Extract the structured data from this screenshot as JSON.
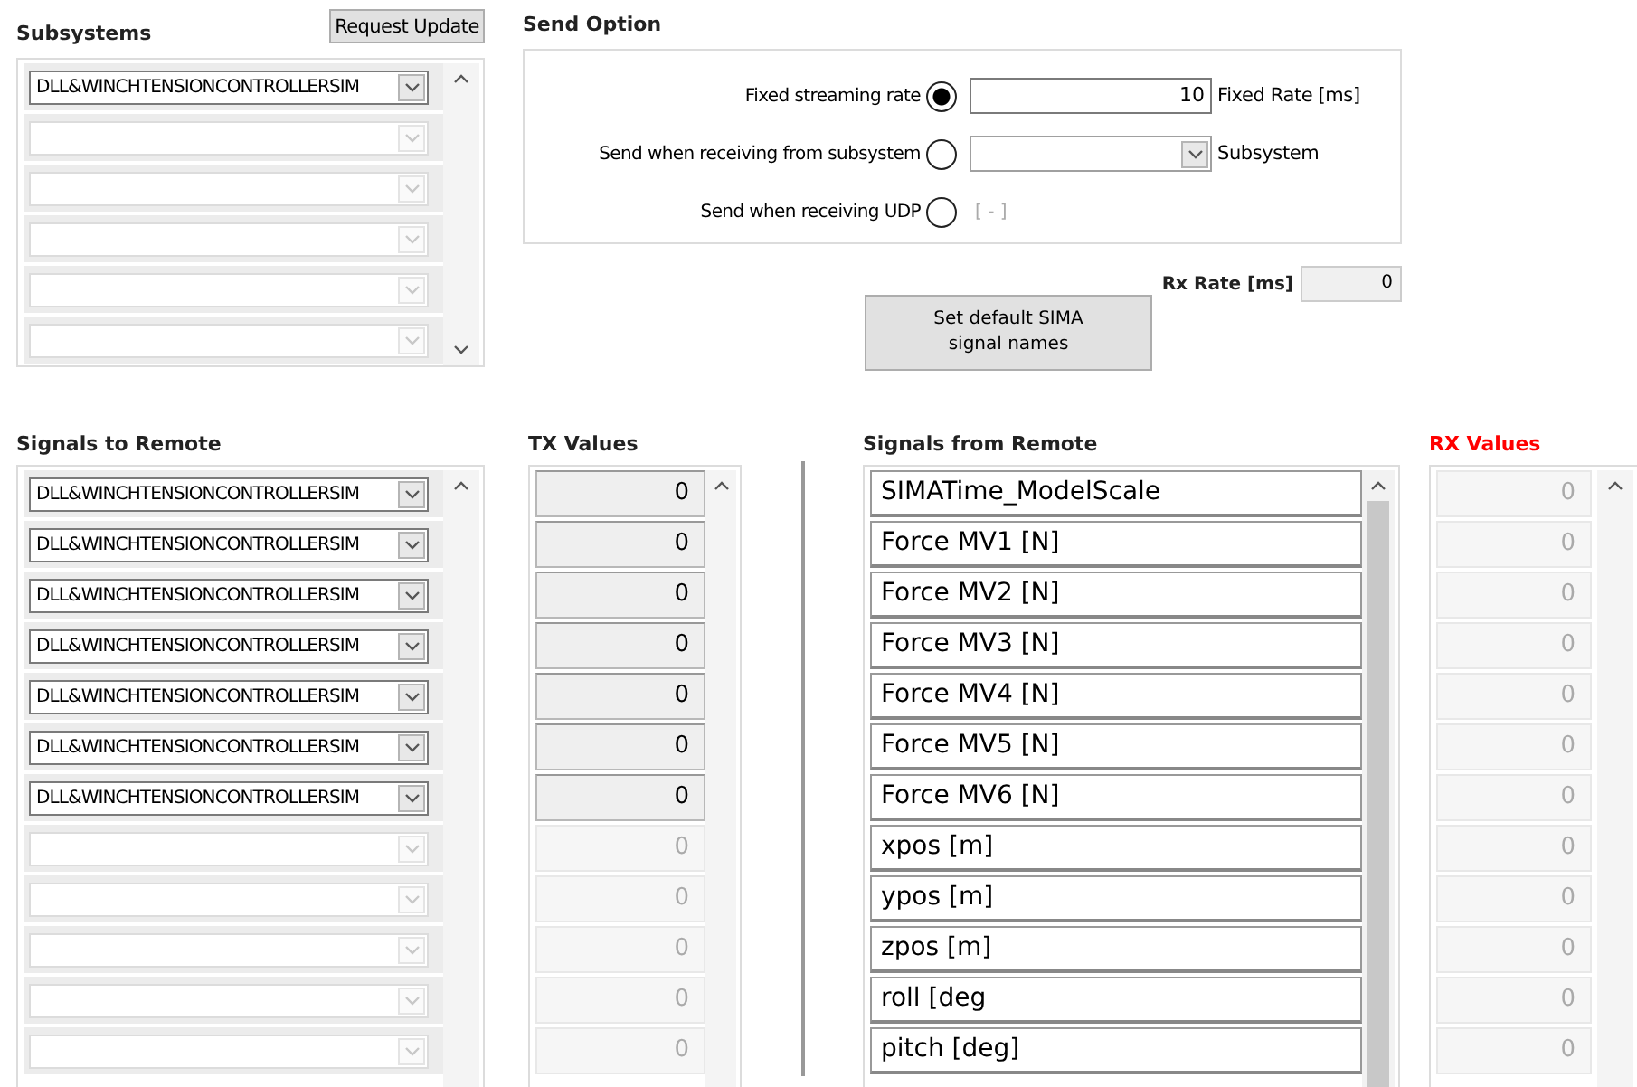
{
  "subsystems": {
    "title": "Subsystems",
    "request_button": "Request Update",
    "items": [
      {
        "value": "DLL&WINCHTENSIONCONTROLLERSIM",
        "disabled": false
      },
      {
        "disabled": true
      },
      {
        "disabled": true
      },
      {
        "disabled": true
      },
      {
        "disabled": true
      },
      {
        "disabled": true
      }
    ]
  },
  "send_option": {
    "title": "Send Option",
    "options": [
      {
        "kind": "fixed",
        "label": "Fixed streaming rate",
        "selected": true,
        "value": "10",
        "unit": "Fixed Rate [ms]"
      },
      {
        "kind": "subsystem",
        "label": "Send when receiving from subsystem",
        "selected": false,
        "unit": "Subsystem"
      },
      {
        "kind": "udp",
        "label": "Send when receiving UDP",
        "selected": false,
        "note": "[ - ]"
      }
    ]
  },
  "rx_rate": {
    "label": "Rx Rate [ms]",
    "value": "0"
  },
  "default_button": "Set default SIMA\nsignal names",
  "signals_to_remote": {
    "title": "Signals to Remote",
    "items": [
      {
        "value": "DLL&WINCHTENSIONCONTROLLERSIM",
        "disabled": false
      },
      {
        "value": "DLL&WINCHTENSIONCONTROLLERSIM",
        "disabled": false
      },
      {
        "value": "DLL&WINCHTENSIONCONTROLLERSIM",
        "disabled": false
      },
      {
        "value": "DLL&WINCHTENSIONCONTROLLERSIM",
        "disabled": false
      },
      {
        "value": "DLL&WINCHTENSIONCONTROLLERSIM",
        "disabled": false
      },
      {
        "value": "DLL&WINCHTENSIONCONTROLLERSIM",
        "disabled": false
      },
      {
        "value": "DLL&WINCHTENSIONCONTROLLERSIM",
        "disabled": false
      },
      {
        "disabled": true
      },
      {
        "disabled": true
      },
      {
        "disabled": true
      },
      {
        "disabled": true
      },
      {
        "disabled": true
      }
    ]
  },
  "tx_values": {
    "title": "TX Values",
    "items": [
      {
        "value": "0",
        "disabled": false
      },
      {
        "value": "0",
        "disabled": false
      },
      {
        "value": "0",
        "disabled": false
      },
      {
        "value": "0",
        "disabled": false
      },
      {
        "value": "0",
        "disabled": false
      },
      {
        "value": "0",
        "disabled": false
      },
      {
        "value": "0",
        "disabled": false
      },
      {
        "value": "0",
        "disabled": true
      },
      {
        "value": "0",
        "disabled": true
      },
      {
        "value": "0",
        "disabled": true
      },
      {
        "value": "0",
        "disabled": true
      },
      {
        "value": "0",
        "disabled": true
      }
    ]
  },
  "signals_from_remote": {
    "title": "Signals from Remote",
    "items": [
      "SIMATime_ModelScale",
      "Force MV1 [N]",
      "Force MV2 [N]",
      "Force MV3 [N]",
      "Force MV4 [N]",
      "Force MV5 [N]",
      "Force MV6 [N]",
      "xpos [m]",
      "ypos [m]",
      "zpos [m]",
      "roll [deg",
      "pitch [deg]"
    ]
  },
  "rx_values": {
    "title": "RX Values",
    "items": [
      {
        "value": "0",
        "disabled": true
      },
      {
        "value": "0",
        "disabled": true
      },
      {
        "value": "0",
        "disabled": true
      },
      {
        "value": "0",
        "disabled": true
      },
      {
        "value": "0",
        "disabled": true
      },
      {
        "value": "0",
        "disabled": true
      },
      {
        "value": "0",
        "disabled": true
      },
      {
        "value": "0",
        "disabled": true
      },
      {
        "value": "0",
        "disabled": true
      },
      {
        "value": "0",
        "disabled": true
      },
      {
        "value": "0",
        "disabled": true
      },
      {
        "value": "0",
        "disabled": true
      }
    ]
  }
}
